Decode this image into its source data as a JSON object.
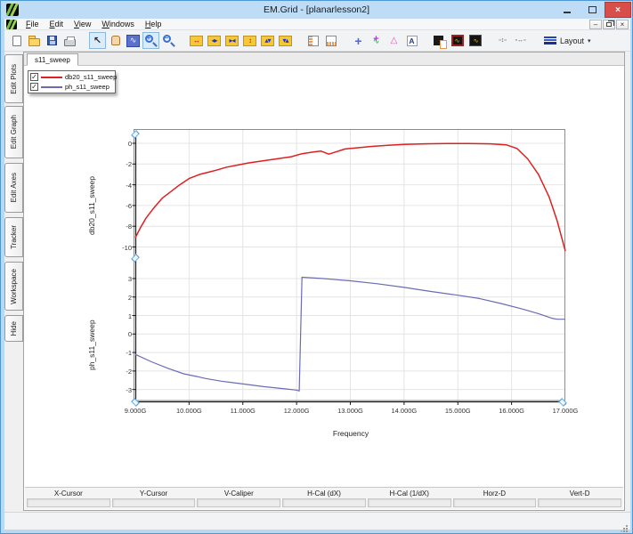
{
  "window": {
    "title": "EM.Grid - [planarlesson2]",
    "controls": [
      {
        "name": "minimize-button",
        "glyph": ""
      },
      {
        "name": "maximize-button",
        "glyph": ""
      },
      {
        "name": "close-button",
        "glyph": "×"
      }
    ]
  },
  "menu": {
    "items": [
      "File",
      "Edit",
      "View",
      "Windows",
      "Help"
    ],
    "mdi_controls": [
      {
        "name": "mdi-minimize-button",
        "glyph": "–"
      },
      {
        "name": "mdi-restore-button",
        "glyph": ""
      },
      {
        "name": "mdi-close-button",
        "glyph": "×"
      }
    ]
  },
  "toolbar": {
    "groups": [
      [
        {
          "name": "new-file-button",
          "glyph": ""
        },
        {
          "name": "open-file-button",
          "glyph": ""
        },
        {
          "name": "save-button",
          "glyph": ""
        },
        {
          "name": "print-button",
          "glyph": ""
        }
      ],
      [
        {
          "name": "pointer-tool-button",
          "glyph": "↖"
        },
        {
          "name": "pan-tool-button",
          "glyph": ""
        },
        {
          "name": "zoom-region-button",
          "glyph": "∿"
        },
        {
          "name": "zoom-in-button",
          "glyph": "+"
        },
        {
          "name": "zoom-out-button",
          "glyph": "−"
        }
      ],
      [
        {
          "name": "expand-x-button",
          "glyph": "↔"
        },
        {
          "name": "contract-x-button",
          "glyph": "◂▸"
        },
        {
          "name": "fit-x-button",
          "glyph": "▸◂"
        },
        {
          "name": "expand-y-button",
          "glyph": "↕"
        },
        {
          "name": "contract-y-button",
          "glyph": "▴▾"
        },
        {
          "name": "fit-y-button",
          "glyph": "▾▴"
        }
      ],
      [
        {
          "name": "left-axis-strip-button",
          "glyph": ""
        },
        {
          "name": "bottom-axis-strip-button",
          "glyph": ""
        }
      ],
      [
        {
          "name": "add-marker-button",
          "glyph": "+"
        },
        {
          "name": "axes-tool-button",
          "glyph": "∿"
        },
        {
          "name": "caliper-tool-button",
          "glyph": "△"
        },
        {
          "name": "text-tool-button",
          "glyph": "A"
        }
      ],
      [
        {
          "name": "plot-window-button",
          "glyph": ""
        },
        {
          "name": "plot-style-red-button",
          "glyph": "∿"
        },
        {
          "name": "plot-style-multi-button",
          "glyph": "∿"
        }
      ],
      [
        {
          "name": "vertical-gap-button",
          "glyph": "▫↕▫"
        },
        {
          "name": "horizontal-gap-button",
          "glyph": "▫↔▫"
        }
      ]
    ],
    "layout": {
      "label": "Layout",
      "caret": "▾"
    }
  },
  "side_tabs": [
    "Edit Plots",
    "Edit Graph",
    "Edit Axes",
    "Tracker",
    "Workspace",
    "Hide"
  ],
  "doc_tabs": [
    "s11_sweep"
  ],
  "legend": {
    "items": [
      {
        "label": "db20_s11_sweep",
        "color": "#dd2020",
        "checked": true
      },
      {
        "label": "ph_s11_sweep",
        "color": "#6b6bb4",
        "checked": true
      }
    ]
  },
  "cursor_bar": {
    "labels": [
      "X-Cursor",
      "Y-Cursor",
      "V-Caliper",
      "H-Cal (dX)",
      "H-Cal (1/dX)",
      "Horz-D",
      "Vert-D"
    ],
    "values": [
      "",
      "",
      "",
      "",
      "",
      "",
      ""
    ]
  },
  "chart_data": [
    {
      "type": "line",
      "title": "",
      "ylabel": "db20_s11_sweep",
      "yticks": [
        0,
        -2,
        -4,
        -6,
        -8,
        -10
      ],
      "ylim": [
        1.4,
        -10.8
      ],
      "grid": true,
      "x_unit": "GHz",
      "series": [
        {
          "name": "db20_s11_sweep",
          "color": "#dd2020",
          "x": [
            9.0,
            9.1,
            9.2,
            9.35,
            9.5,
            9.65,
            9.8,
            10.0,
            10.2,
            10.35,
            10.5,
            10.7,
            10.9,
            11.1,
            11.3,
            11.5,
            11.7,
            11.9,
            12.1,
            12.3,
            12.45,
            12.6,
            12.75,
            12.9,
            13.1,
            13.4,
            13.7,
            14.0,
            14.4,
            14.8,
            15.2,
            15.6,
            15.9,
            16.1,
            16.3,
            16.5,
            16.7,
            16.85,
            17.0
          ],
          "y": [
            -9.1,
            -8.1,
            -7.2,
            -6.2,
            -5.3,
            -4.7,
            -4.1,
            -3.4,
            -3.0,
            -2.8,
            -2.6,
            -2.3,
            -2.1,
            -1.9,
            -1.75,
            -1.6,
            -1.45,
            -1.3,
            -1.0,
            -0.85,
            -0.75,
            -1.05,
            -0.8,
            -0.55,
            -0.45,
            -0.3,
            -0.2,
            -0.1,
            -0.05,
            -0.02,
            -0.02,
            -0.05,
            -0.15,
            -0.5,
            -1.5,
            -3.0,
            -5.2,
            -7.5,
            -10.4
          ]
        }
      ]
    },
    {
      "type": "line",
      "title": "",
      "ylabel": "ph_s11_sweep",
      "xlabel": "Frequency",
      "xticks": [
        "9.000G",
        "10.000G",
        "11.000G",
        "12.000G",
        "13.000G",
        "14.000G",
        "15.000G",
        "16.000G",
        "17.000G"
      ],
      "xtick_values_ghz": [
        9,
        10,
        11,
        12,
        13,
        14,
        15,
        16,
        17
      ],
      "xlim_ghz": [
        9,
        17
      ],
      "yticks": [
        3,
        2,
        1,
        0,
        -1,
        -2,
        -3
      ],
      "ylim": [
        4.0,
        -3.65
      ],
      "grid": true,
      "series": [
        {
          "name": "ph_s11_sweep",
          "color": "#6b6bb4",
          "x": [
            9.0,
            9.3,
            9.6,
            9.9,
            10.15,
            10.3,
            10.6,
            11.0,
            11.4,
            11.8,
            12.0,
            12.05,
            12.1,
            12.5,
            13.0,
            13.5,
            14.0,
            14.5,
            15.0,
            15.4,
            15.8,
            16.2,
            16.5,
            16.75,
            16.85,
            17.0
          ],
          "y": [
            -1.1,
            -1.5,
            -1.85,
            -2.15,
            -2.3,
            -2.4,
            -2.55,
            -2.7,
            -2.85,
            -2.97,
            -3.03,
            -3.08,
            3.07,
            3.0,
            2.88,
            2.72,
            2.52,
            2.3,
            2.1,
            1.92,
            1.65,
            1.35,
            1.1,
            0.85,
            0.8,
            0.8
          ]
        }
      ]
    }
  ]
}
